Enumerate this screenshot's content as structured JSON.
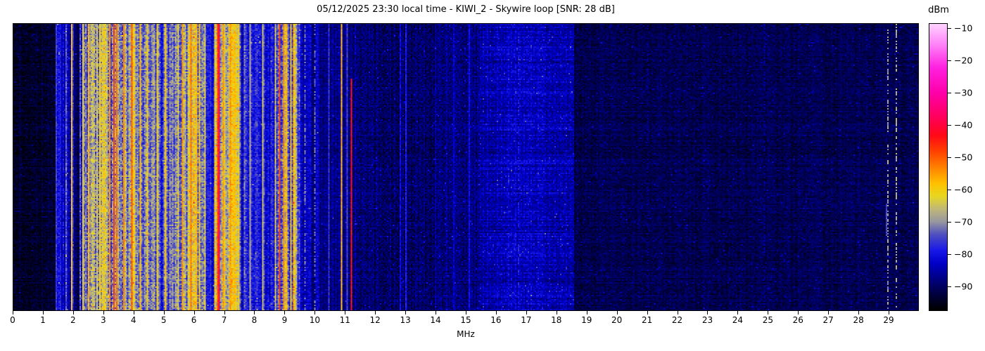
{
  "figure": {
    "title": "05/12/2025 23:30 local time - KIWI_2 - Skywire loop [SNR: 28 dB]",
    "xlabel": "MHz",
    "colorbar_label": "dBm"
  },
  "chart_data": {
    "type": "heatmap",
    "title": "05/12/2025 23:30 local time - KIWI_2 - Skywire loop [SNR: 28 dB]",
    "xlabel": "MHz",
    "x_range_mhz": [
      0,
      30
    ],
    "x_ticks": [
      0,
      1,
      2,
      3,
      4,
      5,
      6,
      7,
      8,
      9,
      10,
      11,
      12,
      13,
      14,
      15,
      16,
      17,
      18,
      19,
      20,
      21,
      22,
      23,
      24,
      25,
      26,
      27,
      28,
      29
    ],
    "legend_position": "right-colorbar",
    "grid": {
      "cols": 644,
      "rows": 204
    },
    "colorbar": {
      "label": "dBm",
      "ticks": [
        -10,
        -20,
        -30,
        -40,
        -50,
        -60,
        -70,
        -80,
        -90
      ],
      "vmin": -97.5,
      "vmax": -8.5
    },
    "colormap": [
      [
        -97.5,
        "#000000"
      ],
      [
        -93.0,
        "#00003a"
      ],
      [
        -88.0,
        "#000080"
      ],
      [
        -83.0,
        "#0000c8"
      ],
      [
        -79.0,
        "#1818e8"
      ],
      [
        -74.0,
        "#5050c0"
      ],
      [
        -70.0,
        "#9898a0"
      ],
      [
        -66.0,
        "#c0b878"
      ],
      [
        -62.0,
        "#e8d820"
      ],
      [
        -58.0,
        "#ffc000"
      ],
      [
        -53.0,
        "#ff8000"
      ],
      [
        -48.0,
        "#ff4000"
      ],
      [
        -43.0,
        "#ff0818"
      ],
      [
        -37.0,
        "#ff0060"
      ],
      [
        -30.0,
        "#ff00a8"
      ],
      [
        -22.0,
        "#ff20e0"
      ],
      [
        -15.0,
        "#ff80f8"
      ],
      [
        -8.5,
        "#ffd0ff"
      ]
    ],
    "bands": [
      {
        "from": 0.0,
        "to": 1.38,
        "base_dbm": -94.0,
        "col_spread": 1.5,
        "noise": 2.6
      },
      {
        "from": 1.38,
        "to": 1.98,
        "base_dbm": -83.0,
        "col_spread": 6.0,
        "noise": 3.5
      },
      {
        "from": 1.98,
        "to": 2.18,
        "base_dbm": -90.0,
        "col_spread": 3.0,
        "noise": 3.0
      },
      {
        "from": 2.18,
        "to": 2.58,
        "base_dbm": -76.0,
        "col_spread": 7.0,
        "noise": 4.0
      },
      {
        "from": 2.58,
        "to": 4.48,
        "base_dbm": -67.0,
        "col_spread": 9.0,
        "noise": 5.0
      },
      {
        "from": 4.48,
        "to": 5.28,
        "base_dbm": -76.0,
        "col_spread": 7.0,
        "noise": 4.5
      },
      {
        "from": 5.28,
        "to": 6.38,
        "base_dbm": -68.0,
        "col_spread": 8.5,
        "noise": 5.0
      },
      {
        "from": 6.38,
        "to": 6.68,
        "base_dbm": -80.0,
        "col_spread": 5.0,
        "noise": 3.5
      },
      {
        "from": 6.68,
        "to": 7.48,
        "base_dbm": -67.0,
        "col_spread": 9.0,
        "noise": 5.0
      },
      {
        "from": 7.48,
        "to": 8.68,
        "base_dbm": -79.0,
        "col_spread": 6.0,
        "noise": 4.0
      },
      {
        "from": 8.68,
        "to": 9.48,
        "base_dbm": -70.0,
        "col_spread": 8.0,
        "noise": 5.0
      },
      {
        "from": 9.48,
        "to": 10.38,
        "base_dbm": -86.0,
        "col_spread": 4.0,
        "noise": 3.0
      },
      {
        "from": 10.38,
        "to": 11.48,
        "base_dbm": -88.0,
        "col_spread": 3.0,
        "noise": 3.0
      },
      {
        "from": 11.48,
        "to": 13.98,
        "base_dbm": -90.0,
        "col_spread": 2.0,
        "noise": 3.0
      },
      {
        "from": 13.98,
        "to": 15.48,
        "base_dbm": -88.0,
        "col_spread": 2.0,
        "noise": 3.0
      },
      {
        "from": 15.48,
        "to": 18.58,
        "base_dbm": -86.0,
        "col_spread": 1.5,
        "noise": 3.0,
        "bump": {
          "center": 16.8,
          "amp": 2.5,
          "sigma": 0.9
        },
        "rowmod": 2.0
      },
      {
        "from": 18.58,
        "to": 30.01,
        "base_dbm": -91.5,
        "col_spread": 1.2,
        "noise": 2.7
      }
    ],
    "lines": [
      {
        "f": 1.44,
        "level_dbm": -76
      },
      {
        "f": 1.56,
        "level_dbm": -79
      },
      {
        "f": 1.93,
        "level_dbm": -59
      },
      {
        "f": 2.31,
        "level_dbm": -61
      },
      {
        "f": 2.5,
        "level_dbm": -57
      },
      {
        "f": 2.88,
        "level_dbm": -60
      },
      {
        "f": 3.2,
        "level_dbm": -54
      },
      {
        "f": 3.33,
        "level_dbm": -48
      },
      {
        "f": 3.42,
        "level_dbm": -52
      },
      {
        "f": 3.64,
        "level_dbm": -53
      },
      {
        "f": 3.95,
        "level_dbm": -50
      },
      {
        "f": 4.2,
        "level_dbm": -58
      },
      {
        "f": 4.77,
        "level_dbm": -61
      },
      {
        "f": 5.06,
        "level_dbm": -59
      },
      {
        "f": 5.62,
        "level_dbm": -55
      },
      {
        "f": 5.91,
        "level_dbm": -52
      },
      {
        "f": 6.07,
        "level_dbm": -57
      },
      {
        "f": 6.8,
        "level_dbm": -48
      },
      {
        "f": 6.84,
        "level_dbm": -39
      },
      {
        "f": 6.96,
        "level_dbm": -55
      },
      {
        "f": 7.22,
        "level_dbm": -55
      },
      {
        "f": 7.35,
        "level_dbm": -58
      },
      {
        "f": 7.85,
        "level_dbm": -68
      },
      {
        "f": 8.29,
        "level_dbm": -66
      },
      {
        "f": 8.83,
        "level_dbm": -48
      },
      {
        "f": 8.96,
        "level_dbm": -54
      },
      {
        "f": 9.06,
        "level_dbm": -57
      },
      {
        "f": 9.22,
        "level_dbm": -59
      },
      {
        "f": 9.65,
        "level_dbm": -72,
        "dotted": true
      },
      {
        "f": 10.0,
        "level_dbm": -73,
        "dotted": true
      },
      {
        "f": 10.45,
        "level_dbm": -77
      },
      {
        "f": 10.9,
        "level_dbm": -57
      },
      {
        "f": 11.06,
        "level_dbm": -76
      },
      {
        "f": 11.22,
        "level_dbm": -43,
        "y0": 0.19
      },
      {
        "f": 12.83,
        "level_dbm": -81
      },
      {
        "f": 13.01,
        "level_dbm": -79
      },
      {
        "f": 14.6,
        "level_dbm": -83
      },
      {
        "f": 15.12,
        "level_dbm": -81
      },
      {
        "f": 16.75,
        "level_dbm": -79,
        "dotted": true
      },
      {
        "f": 21.05,
        "level_dbm": -87,
        "dotted": true
      },
      {
        "f": 24.9,
        "level_dbm": -86,
        "dotted": true
      },
      {
        "f": 28.93,
        "level_dbm": -75,
        "y0": 0.63,
        "y1": 0.74
      },
      {
        "f": 29.02,
        "level_dbm": -69,
        "dotted": true
      },
      {
        "f": 29.28,
        "level_dbm": -68,
        "dotted": true
      }
    ]
  }
}
